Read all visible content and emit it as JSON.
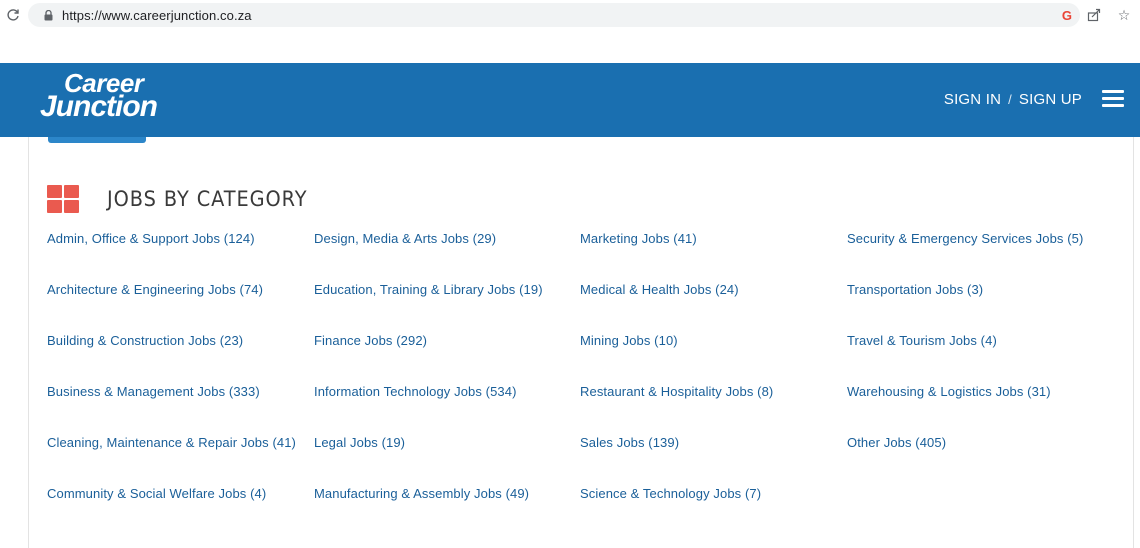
{
  "browser": {
    "url": "https://www.careerjunction.co.za"
  },
  "header": {
    "logo_line1": "Career",
    "logo_line2": "Junction",
    "sign_in": "SIGN IN",
    "separator": "/",
    "sign_up": "SIGN UP"
  },
  "section": {
    "title": "JOBS BY CATEGORY"
  },
  "categories": {
    "col1": [
      "Admin, Office & Support Jobs (124)",
      "Architecture & Engineering Jobs (74)",
      "Building & Construction Jobs (23)",
      "Business & Management Jobs (333)",
      "Cleaning, Maintenance & Repair Jobs (41)",
      "Community & Social Welfare Jobs (4)"
    ],
    "col2": [
      "Design, Media & Arts Jobs (29)",
      "Education, Training & Library Jobs (19)",
      "Finance Jobs (292)",
      "Information Technology Jobs (534)",
      "Legal Jobs (19)",
      "Manufacturing & Assembly Jobs (49)"
    ],
    "col3": [
      "Marketing Jobs (41)",
      "Medical & Health Jobs (24)",
      "Mining Jobs (10)",
      "Restaurant & Hospitality Jobs (8)",
      "Sales Jobs (139)",
      "Science & Technology Jobs (7)"
    ],
    "col4": [
      "Security & Emergency Services Jobs (5)",
      "Transportation Jobs (3)",
      "Travel & Tourism Jobs (4)",
      "Warehousing & Logistics Jobs (31)",
      "Other Jobs (405)"
    ]
  },
  "colors": {
    "header_bg": "#1a6fb0",
    "link": "#1a5f99",
    "category_icon": "#ea5a4f"
  }
}
